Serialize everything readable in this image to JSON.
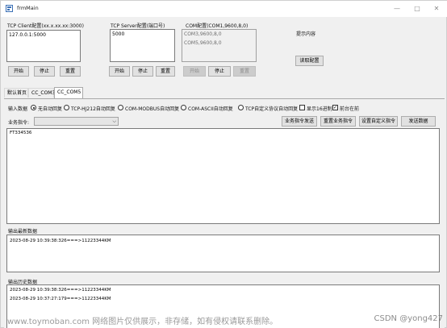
{
  "window": {
    "title": "frmMain",
    "minimize_glyph": "—",
    "maximize_glyph": "□",
    "close_glyph": "✕"
  },
  "tcp_client": {
    "label": "TCP Client配置(xx.x.xx.xx:3000)",
    "items": [
      "127.0.0.1:5000"
    ],
    "start": "开始",
    "stop": "停止",
    "reset": "重置"
  },
  "tcp_server": {
    "label": "TCP Server配置(端口号)",
    "items": [
      "5000"
    ],
    "start": "开始",
    "stop": "停止",
    "reset": "重置"
  },
  "com": {
    "label": "COM配置(COM1,9600,8,0)",
    "items": [
      "COM3,9600,8,0",
      "COM5,9600,8,0"
    ],
    "start": "开始",
    "stop": "停止",
    "reset": "重置"
  },
  "hint": {
    "label": "提示内容",
    "read_config": "读取配置"
  },
  "tabs": [
    "默认首页",
    "CC_COM3",
    "CC_COM5"
  ],
  "active_tab": "CC_COM5",
  "panel": {
    "input_label": "输入数据",
    "options": [
      "无自动回复",
      "TCP-HJ212自动回复",
      "COM-MODBUS自动回复",
      "COM-ASCII自动回复",
      "TCP自定义协议自动回复"
    ],
    "selected_option": "无自动回复",
    "hex_display": "显示16进制",
    "hex_checked": false,
    "top_most": "前台在前",
    "top_most_checked": true,
    "command_label": "业务指令:",
    "command_value": "",
    "send_command": "业务指令发送",
    "reset_command": "重置业务指令",
    "set_custom_command": "设置自定义指令",
    "send_data": "发送数据",
    "input_text": "FT334536",
    "latest_label": "输出最新数据",
    "latest_lines": [
      "2023-08-29 10:39:38:326===>11223344KM"
    ],
    "history_label": "输出历史数据",
    "history_lines": [
      "2023-08-29 10:39:38:326===>11223344KM",
      "2023-08-29 10:37:27:179===>11223344KM"
    ]
  },
  "watermark": {
    "text": "www.toymoban.com 网络图片仅供展示，非存储，如有侵权请联系删除。",
    "credit": "CSDN @yong427"
  },
  "colors": {
    "window_bg": "#f0f0f0",
    "button_bg": "#e1e1e1",
    "disabled_button_bg": "#cccccc",
    "text": "#000000"
  }
}
